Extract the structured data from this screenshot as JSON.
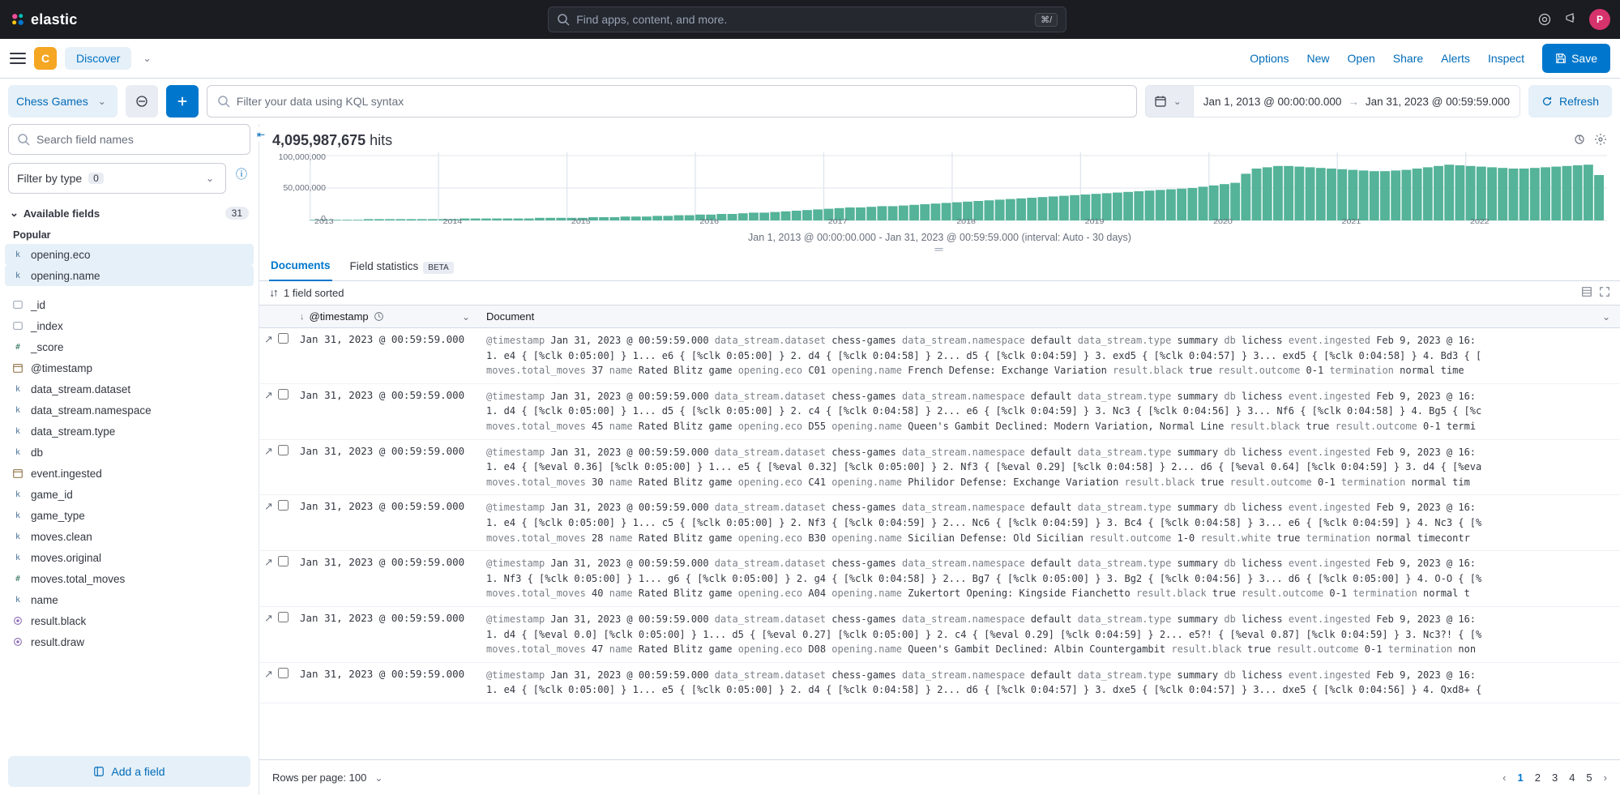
{
  "brand": "elastic",
  "global_search_placeholder": "Find apps, content, and more.",
  "global_search_kbd": "⌘/",
  "avatar_letter": "P",
  "app_badge_letter": "C",
  "discover_label": "Discover",
  "appbar_links": {
    "options": "Options",
    "new": "New",
    "open": "Open",
    "share": "Share",
    "alerts": "Alerts",
    "inspect": "Inspect"
  },
  "save_label": "Save",
  "dataview_label": "Chess Games",
  "kql_placeholder": "Filter your data using KQL syntax",
  "date_from": "Jan 1, 2013 @ 00:00:00.000",
  "date_to": "Jan 31, 2023 @ 00:59:59.000",
  "refresh_label": "Refresh",
  "field_search_placeholder": "Search field names",
  "filter_type_label": "Filter by type",
  "filter_type_count": "0",
  "available_fields_label": "Available fields",
  "available_fields_count": "31",
  "popular_label": "Popular",
  "popular_fields": [
    {
      "icon": "k",
      "name": "opening.eco"
    },
    {
      "icon": "k",
      "name": "opening.name"
    }
  ],
  "fields": [
    {
      "icon": "id",
      "name": "_id"
    },
    {
      "icon": "id",
      "name": "_index"
    },
    {
      "icon": "num",
      "name": "_score"
    },
    {
      "icon": "date",
      "name": "@timestamp"
    },
    {
      "icon": "k",
      "name": "data_stream.dataset"
    },
    {
      "icon": "k",
      "name": "data_stream.namespace"
    },
    {
      "icon": "k",
      "name": "data_stream.type"
    },
    {
      "icon": "k",
      "name": "db"
    },
    {
      "icon": "date",
      "name": "event.ingested"
    },
    {
      "icon": "k",
      "name": "game_id"
    },
    {
      "icon": "k",
      "name": "game_type"
    },
    {
      "icon": "k",
      "name": "moves.clean"
    },
    {
      "icon": "k",
      "name": "moves.original"
    },
    {
      "icon": "num",
      "name": "moves.total_moves"
    },
    {
      "icon": "k",
      "name": "name"
    },
    {
      "icon": "bool",
      "name": "result.black"
    },
    {
      "icon": "bool",
      "name": "result.draw"
    }
  ],
  "add_field_label": "Add a field",
  "hits_count": "4,095,987,675",
  "hits_word": "hits",
  "y_labels": [
    "100,000,000",
    "50,000,000",
    "0"
  ],
  "x_labels": [
    "2013",
    "2014",
    "2015",
    "2016",
    "2017",
    "2018",
    "2019",
    "2020",
    "2021",
    "2022"
  ],
  "chart_caption": "Jan 1, 2013 @ 00:00:00.000 - Jan 31, 2023 @ 00:59:59.000 (interval: Auto - 30 days)",
  "tabs": {
    "documents": "Documents",
    "field_stats": "Field statistics",
    "beta": "BETA"
  },
  "sort_label": "1 field sorted",
  "col_ts": "@timestamp",
  "col_doc": "Document",
  "rows": [
    {
      "ts": "Jan 31, 2023 @ 00:59:59.000",
      "l1": "@timestamp Jan 31, 2023 @ 00:59:59.000 data_stream.dataset chess-games data_stream.namespace default data_stream.type summary db lichess event.ingested Feb 9, 2023 @ 16:",
      "l2": "1. e4 { [%clk 0:05:00] } 1... e6 { [%clk 0:05:00] } 2. d4 { [%clk 0:04:58] } 2... d5 { [%clk 0:04:59] } 3. exd5 { [%clk 0:04:57] } 3... exd5 { [%clk 0:04:58] } 4. Bd3 { [",
      "l3": "moves.total_moves 37 name Rated Blitz game opening.eco C01 opening.name French Defense: Exchange Variation result.black true result.outcome 0-1 termination normal time"
    },
    {
      "ts": "Jan 31, 2023 @ 00:59:59.000",
      "l1": "@timestamp Jan 31, 2023 @ 00:59:59.000 data_stream.dataset chess-games data_stream.namespace default data_stream.type summary db lichess event.ingested Feb 9, 2023 @ 16:",
      "l2": "1. d4 { [%clk 0:05:00] } 1... d5 { [%clk 0:05:00] } 2. c4 { [%clk 0:04:58] } 2... e6 { [%clk 0:04:59] } 3. Nc3 { [%clk 0:04:56] } 3... Nf6 { [%clk 0:04:58] } 4. Bg5 { [%c",
      "l3": "moves.total_moves 45 name Rated Blitz game opening.eco D55 opening.name Queen's Gambit Declined: Modern Variation, Normal Line result.black true result.outcome 0-1 termi"
    },
    {
      "ts": "Jan 31, 2023 @ 00:59:59.000",
      "l1": "@timestamp Jan 31, 2023 @ 00:59:59.000 data_stream.dataset chess-games data_stream.namespace default data_stream.type summary db lichess event.ingested Feb 9, 2023 @ 16:",
      "l2": "1. e4 { [%eval 0.36] [%clk 0:05:00] } 1... e5 { [%eval 0.32] [%clk 0:05:00] } 2. Nf3 { [%eval 0.29] [%clk 0:04:58] } 2... d6 { [%eval 0.64] [%clk 0:04:59] } 3. d4 { [%eva",
      "l3": "moves.total_moves 30 name Rated Blitz game opening.eco C41 opening.name Philidor Defense: Exchange Variation result.black true result.outcome 0-1 termination normal tim"
    },
    {
      "ts": "Jan 31, 2023 @ 00:59:59.000",
      "l1": "@timestamp Jan 31, 2023 @ 00:59:59.000 data_stream.dataset chess-games data_stream.namespace default data_stream.type summary db lichess event.ingested Feb 9, 2023 @ 16:",
      "l2": "1. e4 { [%clk 0:05:00] } 1... c5 { [%clk 0:05:00] } 2. Nf3 { [%clk 0:04:59] } 2... Nc6 { [%clk 0:04:59] } 3. Bc4 { [%clk 0:04:58] } 3... e6 { [%clk 0:04:59] } 4. Nc3 { [%",
      "l3": "moves.total_moves 28 name Rated Blitz game opening.eco B30 opening.name Sicilian Defense: Old Sicilian result.outcome 1-0 result.white true termination normal timecontr"
    },
    {
      "ts": "Jan 31, 2023 @ 00:59:59.000",
      "l1": "@timestamp Jan 31, 2023 @ 00:59:59.000 data_stream.dataset chess-games data_stream.namespace default data_stream.type summary db lichess event.ingested Feb 9, 2023 @ 16:",
      "l2": "1. Nf3 { [%clk 0:05:00] } 1... g6 { [%clk 0:05:00] } 2. g4 { [%clk 0:04:58] } 2... Bg7 { [%clk 0:05:00] } 3. Bg2 { [%clk 0:04:56] } 3... d6 { [%clk 0:05:00] } 4. O-O { [%",
      "l3": "moves.total_moves 40 name Rated Blitz game opening.eco A04 opening.name Zukertort Opening: Kingside Fianchetto result.black true result.outcome 0-1 termination normal t"
    },
    {
      "ts": "Jan 31, 2023 @ 00:59:59.000",
      "l1": "@timestamp Jan 31, 2023 @ 00:59:59.000 data_stream.dataset chess-games data_stream.namespace default data_stream.type summary db lichess event.ingested Feb 9, 2023 @ 16:",
      "l2": "1. d4 { [%eval 0.0] [%clk 0:05:00] } 1... d5 { [%eval 0.27] [%clk 0:05:00] } 2. c4 { [%eval 0.29] [%clk 0:04:59] } 2... e5?! { [%eval 0.87] [%clk 0:04:59] } 3. Nc3?! { [%",
      "l3": "moves.total_moves 47 name Rated Blitz game opening.eco D08 opening.name Queen's Gambit Declined: Albin Countergambit result.black true result.outcome 0-1 termination non"
    },
    {
      "ts": "Jan 31, 2023 @ 00:59:59.000",
      "l1": "@timestamp Jan 31, 2023 @ 00:59:59.000 data_stream.dataset chess-games data_stream.namespace default data_stream.type summary db lichess event.ingested Feb 9, 2023 @ 16:",
      "l2": "1. e4 { [%clk 0:05:00] } 1... e5 { [%clk 0:05:00] } 2. d4 { [%clk 0:04:58] } 2... d6 { [%clk 0:04:57] } 3. dxe5 { [%clk 0:04:57] } 3... dxe5 { [%clk 0:04:56] } 4. Qxd8+ {",
      "l3": ""
    }
  ],
  "rows_per_page_label": "Rows per page: 100",
  "pages": [
    "1",
    "2",
    "3",
    "4",
    "5"
  ],
  "chart_data": {
    "type": "bar",
    "title": "",
    "xlabel": "",
    "ylabel": "",
    "ylim": [
      0,
      100000000
    ],
    "categories_note": "monthly buckets 2013-01 through 2023-01 (121 bars)",
    "values": [
      1,
      1,
      1,
      1,
      1,
      2,
      2,
      2,
      2,
      2,
      2,
      2,
      2,
      2,
      3,
      3,
      3,
      3,
      3,
      3,
      3,
      4,
      4,
      4,
      4,
      4,
      5,
      5,
      5,
      6,
      6,
      6,
      7,
      7,
      8,
      8,
      9,
      9,
      10,
      10,
      11,
      12,
      12,
      13,
      14,
      15,
      16,
      17,
      18,
      19,
      20,
      20,
      21,
      22,
      22,
      23,
      24,
      25,
      26,
      27,
      28,
      29,
      30,
      31,
      32,
      33,
      34,
      35,
      36,
      37,
      38,
      39,
      40,
      41,
      42,
      43,
      44,
      45,
      46,
      47,
      48,
      49,
      50,
      52,
      54,
      56,
      58,
      72,
      80,
      82,
      84,
      84,
      83,
      82,
      81,
      80,
      79,
      78,
      77,
      76,
      76,
      77,
      78,
      80,
      82,
      84,
      86,
      85,
      84,
      83,
      82,
      81,
      80,
      80,
      81,
      82,
      83,
      84,
      85,
      86,
      70
    ]
  }
}
